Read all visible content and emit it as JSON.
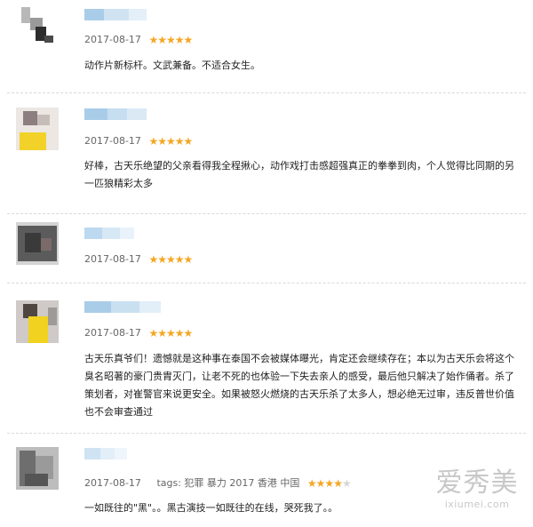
{
  "reviews": [
    {
      "date": "2017-08-17",
      "rating": 5,
      "tags": "",
      "content": "动作片新标杆。文武兼备。不适合女生。"
    },
    {
      "date": "2017-08-17",
      "rating": 5,
      "tags": "",
      "content": "好棒，古天乐绝望的父亲看得我全程揪心，动作戏打击感超强真正的拳拳到肉，个人觉得比同期的另一匹狼精彩太多"
    },
    {
      "date": "2017-08-17",
      "rating": 5,
      "tags": "",
      "content": ""
    },
    {
      "date": "2017-08-17",
      "rating": 5,
      "tags": "",
      "content": "古天乐真爷们！遗憾就是这种事在泰国不会被媒体曝光，肯定还会继续存在；本以为古天乐会将这个臭名昭著的豪门贵胄灭门，让老不死的也体验一下失去亲人的感受，最后他只解决了始作俑者。杀了策划者，对崔警官来说更安全。如果被怒火燃烧的古天乐杀了太多人，想必绝无过审，违反普世价值也不会审查通过"
    },
    {
      "date": "2017-08-17",
      "rating": 4,
      "tags": "tags: 犯罪 暴力 2017 香港 中国",
      "content": "一如既往的\"黑\"。。黑古演技一如既往的在线，哭死我了。。"
    }
  ],
  "watermark": {
    "main": "爱秀美",
    "sub": "ixiumei.com"
  },
  "colors": {
    "star_on": "#f5a623",
    "star_off": "#d6d6d6",
    "text": "#222222",
    "meta": "#666666",
    "divider": "#d9d9d9"
  }
}
